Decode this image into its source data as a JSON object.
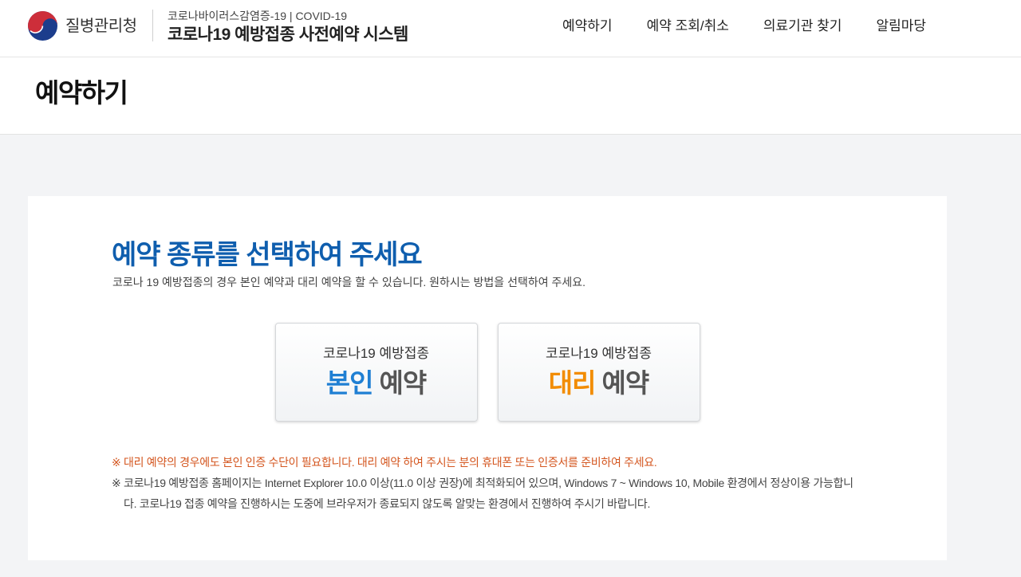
{
  "header": {
    "logo_icon": "government-taegeuk-emblem",
    "org_name": "질병관리청",
    "subtitle": "코로나바이러스감염증-19 | COVID-19",
    "title": "코로나19 예방접종 사전예약 시스템",
    "nav": [
      {
        "label": "예약하기"
      },
      {
        "label": "예약 조회/취소"
      },
      {
        "label": "의료기관 찾기"
      },
      {
        "label": "알림마당"
      }
    ]
  },
  "page": {
    "title": "예약하기"
  },
  "selection": {
    "heading": "예약 종류를 선택하여 주세요",
    "heading_color": "#0f5eae",
    "description": "코로나 19 예방접종의 경우 본인 예약과 대리 예약을 할 수 있습니다. 원하시는 방법을 선택하여 주세요.",
    "options": [
      {
        "caption": "코로나19 예방접종",
        "highlight": "본인",
        "suffix": "예약",
        "highlight_color": "#1f7fd3"
      },
      {
        "caption": "코로나19 예방접종",
        "highlight": "대리",
        "suffix": "예약",
        "highlight_color": "#f28c00"
      }
    ]
  },
  "notes": [
    {
      "marker": "※",
      "text": "대리 예약의 경우에도 본인 인증 수단이 필요합니다. 대리 예약 하여 주시는 분의 휴대폰 또는 인증서를 준비하여 주세요.",
      "color": "#d4561f"
    },
    {
      "marker": "※",
      "text": "코로나19 예방접종 홈페이지는 Internet Explorer 10.0 이상(11.0 이상 권장)에 최적화되어 있으며, Windows 7 ~ Windows 10, Mobile 환경에서 정상이용 가능합니다. 코로나19 접종 예약을 진행하시는 도중에 브라우저가 종료되지 않도록 알맞는 환경에서 진행하여 주시기 바랍니다.",
      "color": "#444444"
    }
  ],
  "colors": {
    "page_background": "#f3f4f6",
    "suffix_text": "#555555"
  }
}
